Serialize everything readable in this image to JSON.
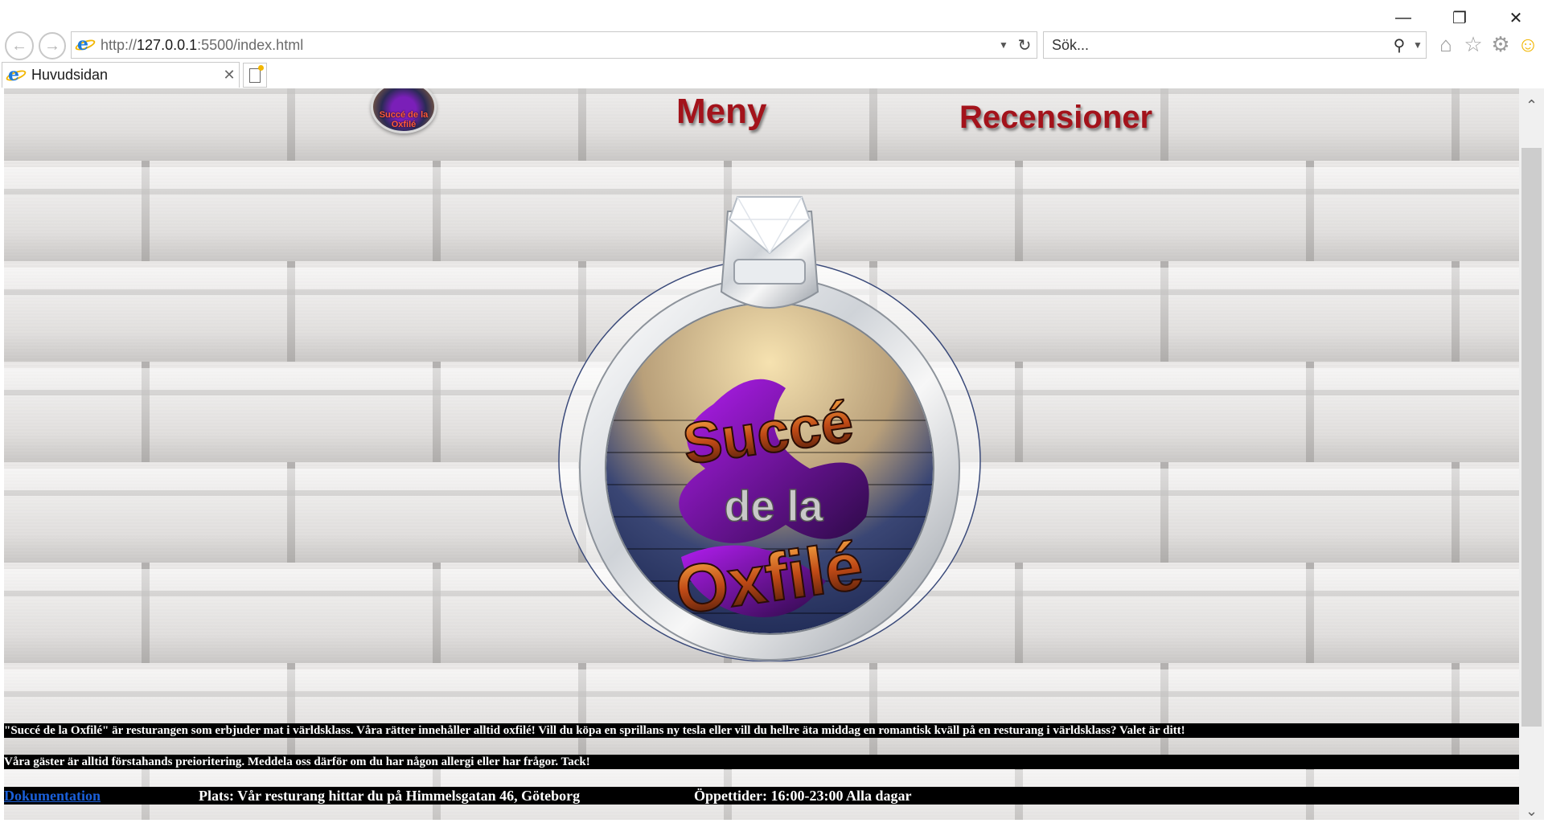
{
  "browser": {
    "address": {
      "prefix": "http://",
      "host": "127.0.0.1",
      "rest": ":5500/index.html"
    },
    "search": {
      "placeholder": "Sök..."
    },
    "tab": {
      "title": "Huvudsidan"
    }
  },
  "page": {
    "logo_text": "Succé de la Oxfilé",
    "nav": {
      "meny": "Meny",
      "recensioner": "Recensioner"
    },
    "hero": {
      "line1": "Succé",
      "line2": "de la",
      "line3": "Oxfilé"
    },
    "intro": "\"Succé de la Oxfilé\" är resturangen som erbjuder mat i världsklass. Våra rätter innehåller alltid oxfilé! Vill du köpa en sprillans ny tesla eller vill du hellre äta middag en romantisk kväll på en resturang i världsklass? Valet är ditt!",
    "guests": "Våra gäster är alltid förstahands preioritering. Meddela oss därför om du har någon allergi eller har frågor. Tack!",
    "footer": {
      "doc_link": "Dokumentation",
      "location": "Plats: Vår resturang hittar du på Himmelsgatan 46, Göteborg",
      "hours": "Öppettider: 16:00-23:00 Alla dagar"
    }
  },
  "colors": {
    "nav_text": "#a3131b",
    "strip_bg": "#000000",
    "link": "#1a5fd8"
  }
}
